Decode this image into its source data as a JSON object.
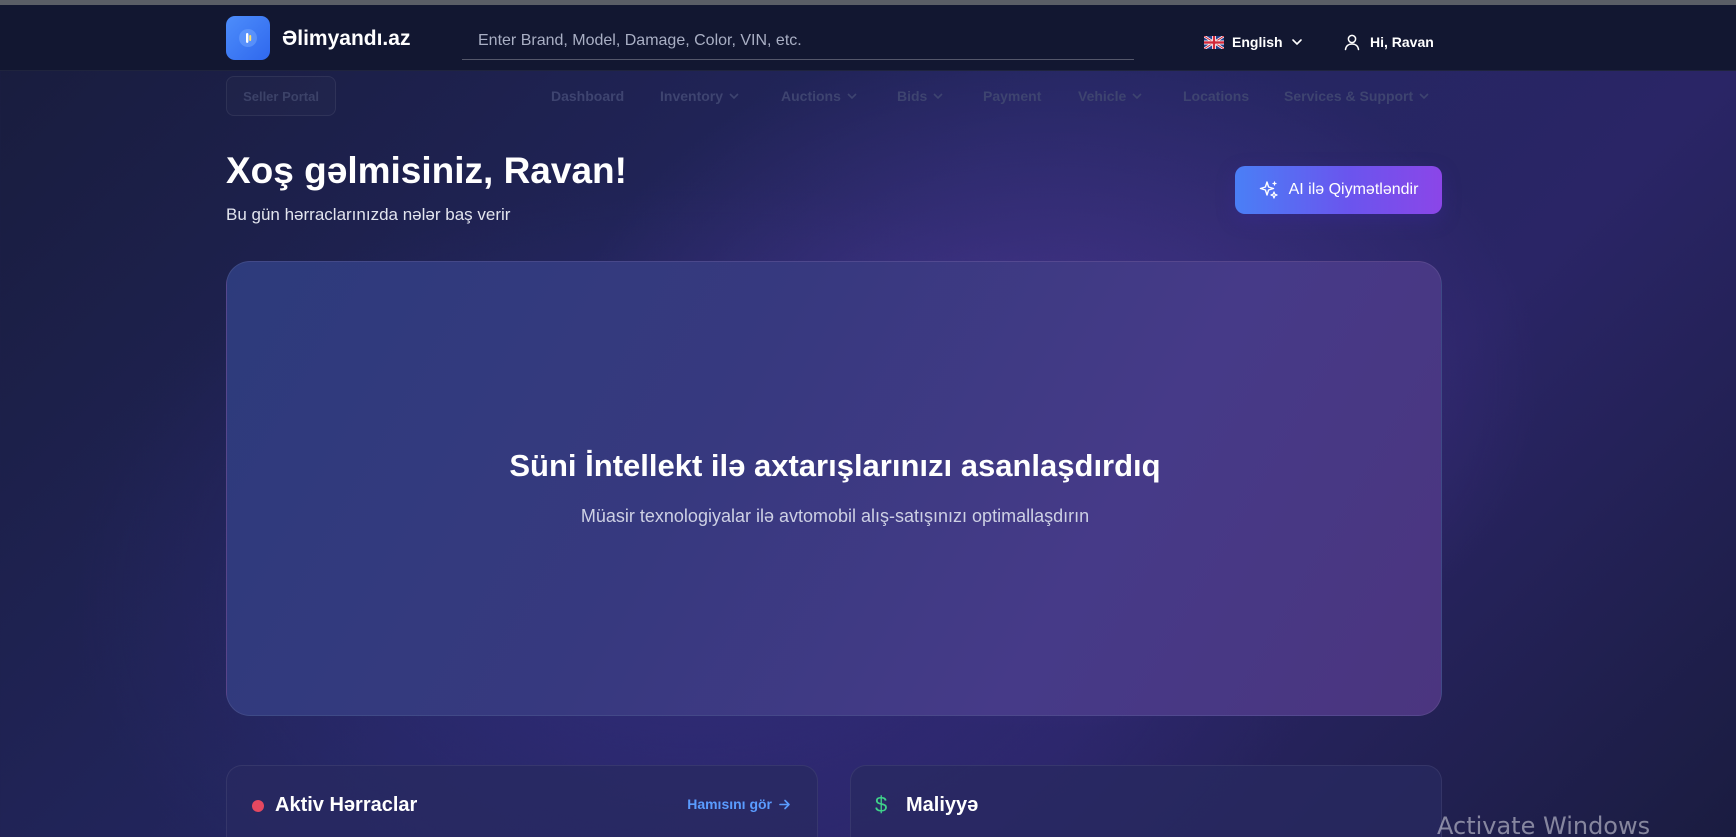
{
  "header": {
    "brand": "Əlimyandı.az",
    "search": {
      "placeholder": "Enter Brand, Model, Damage, Color, VIN, etc.",
      "value": ""
    },
    "language": {
      "label": "English",
      "flag": "uk-flag-icon"
    },
    "user": {
      "greeting": "Hi, Ravan",
      "icon": "user-icon"
    }
  },
  "subnav": {
    "portal": "Seller Portal",
    "items": [
      {
        "label": "Dashboard",
        "dropdown": false
      },
      {
        "label": "Inventory",
        "dropdown": true
      },
      {
        "label": "Auctions",
        "dropdown": true
      },
      {
        "label": "Bids",
        "dropdown": true
      },
      {
        "label": "Payment",
        "dropdown": false
      },
      {
        "label": "Vehicle",
        "dropdown": true
      },
      {
        "label": "Locations",
        "dropdown": false
      },
      {
        "label": "Services & Support",
        "dropdown": true
      }
    ]
  },
  "welcome": {
    "title": "Xoş gəlmisiniz, Ravan!",
    "subtitle": "Bu gün hərraclarınızda nələr baş verir"
  },
  "ai_button": {
    "label": "AI ilə Qiymətləndir",
    "icon": "sparkles-icon"
  },
  "hero": {
    "title": "Süni İntellekt ilə axtarışlarınızı asanlaşdırdıq",
    "subtitle": "Müasir texnologiyalar ilə avtomobil alış-satışınızı optimallaşdırın"
  },
  "cards": {
    "auctions": {
      "title": "Aktiv Hərraclar",
      "link": "Hamısını gör"
    },
    "finance": {
      "title": "Maliyyə",
      "icon": "dollar-icon"
    }
  },
  "os_watermark": "Activate Windows",
  "colors": {
    "accent_blue": "#4a7ff6",
    "accent_purple": "#8b46e8",
    "link": "#5a9cff",
    "live_dot": "#e54860",
    "finance_green": "#3fd28a"
  }
}
